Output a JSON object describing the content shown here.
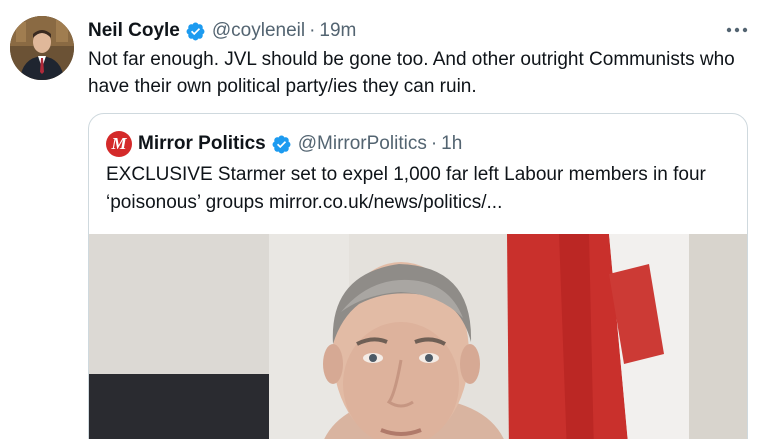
{
  "tweet": {
    "author_name": "Neil Coyle",
    "handle": "@coyleneil",
    "separator": "·",
    "time": "19m",
    "text": "Not far enough. JVL should be gone too. And other outright Communists who have their own political party/ies they can ruin.",
    "verified": true
  },
  "quote": {
    "author_name": "Mirror Politics",
    "avatar_letter": "M",
    "handle": "@MirrorPolitics",
    "separator": "·",
    "time": "1h",
    "text": "EXCLUSIVE Starmer set to expel 1,000 far left Labour members in four ‘poisonous’ groups mirror.co.uk/news/politics/...",
    "verified": true
  },
  "icons": {
    "more": "more-options-icon",
    "verified": "verified-badge-icon"
  },
  "colors": {
    "verified_blue": "#1d9bf0",
    "muted_text": "#536471",
    "border": "#cfd9de",
    "mirror_red": "#d42a2a"
  }
}
